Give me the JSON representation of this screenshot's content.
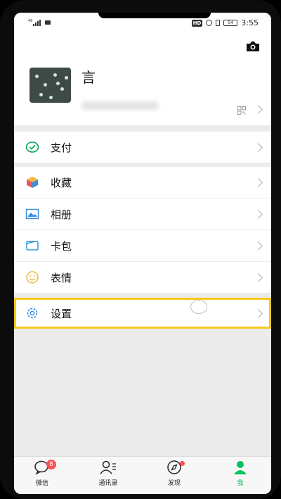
{
  "status_bar": {
    "signal_text": "46",
    "hd_label": "HD",
    "battery_level": "54",
    "time": "3:55"
  },
  "profile": {
    "name": "言"
  },
  "menu": {
    "pay": "支付",
    "favorites": "收藏",
    "album": "相册",
    "cards": "卡包",
    "stickers": "表情",
    "settings": "设置"
  },
  "tabbar": {
    "chats": "微信",
    "chats_badge": "8",
    "contacts": "通讯录",
    "discover": "发现",
    "me": "我",
    "active_color": "#07c160",
    "badge_color": "#fa5151"
  },
  "highlight_color": "#f6c91a"
}
